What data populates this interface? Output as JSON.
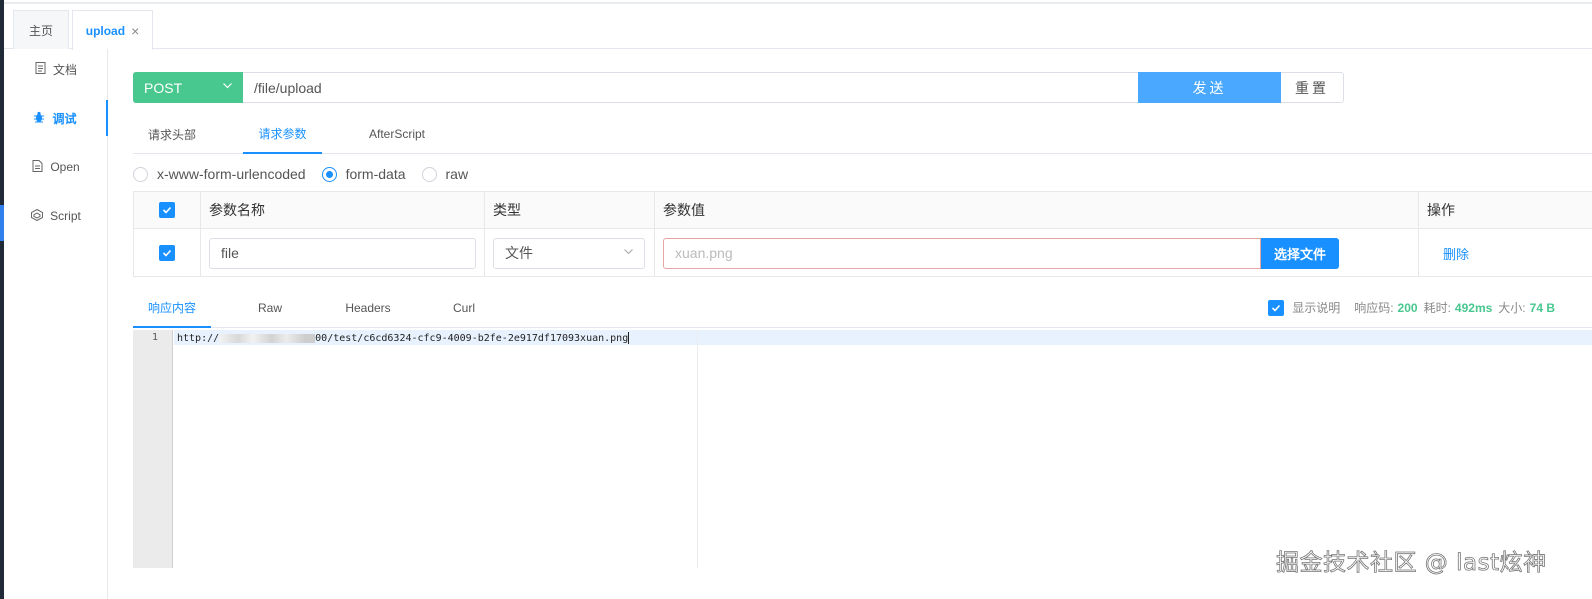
{
  "page_tabs": {
    "home": "主页",
    "active": "upload",
    "close": "×"
  },
  "side_menu": [
    {
      "label": "文档",
      "icon": "document-icon"
    },
    {
      "label": "调试",
      "icon": "bug-icon"
    },
    {
      "label": "Open",
      "icon": "file-icon"
    },
    {
      "label": "Script",
      "icon": "code-icon"
    }
  ],
  "request": {
    "method": "POST",
    "url": "/file/upload",
    "send_label": "发送",
    "reset_label": "重置"
  },
  "request_tabs": [
    "请求头部",
    "请求参数",
    "AfterScript"
  ],
  "request_tab_active": "请求参数",
  "body_types": [
    "x-www-form-urlencoded",
    "form-data",
    "raw"
  ],
  "body_type_selected": "form-data",
  "params_table": {
    "headers": [
      "参数名称",
      "类型",
      "参数值",
      "操作"
    ],
    "rows": [
      {
        "checked": true,
        "name": "file",
        "type": "文件",
        "value_placeholder": "xuan.png",
        "file_button": "选择文件",
        "action": "删除"
      }
    ]
  },
  "response": {
    "tabs": [
      "响应内容",
      "Raw",
      "Headers",
      "Curl"
    ],
    "active_tab": "响应内容",
    "show_desc_label": "显示说明",
    "show_desc_checked": true,
    "status_label": "响应码:",
    "status_value": "200",
    "time_label": "耗时:",
    "time_value": "492ms",
    "size_label": "大小:",
    "size_value": "74 B",
    "line_number": "1",
    "body_prefix": "http://",
    "body_suffix": "00/test/c6cd6324-cfc9-4009-b2fe-2e917df17093xuan.png"
  },
  "watermark": "掘金技术社区 @ last炫神",
  "colors": {
    "method_green": "#48c78e",
    "send_blue": "#4aa8ff",
    "primary": "#1890ff"
  }
}
